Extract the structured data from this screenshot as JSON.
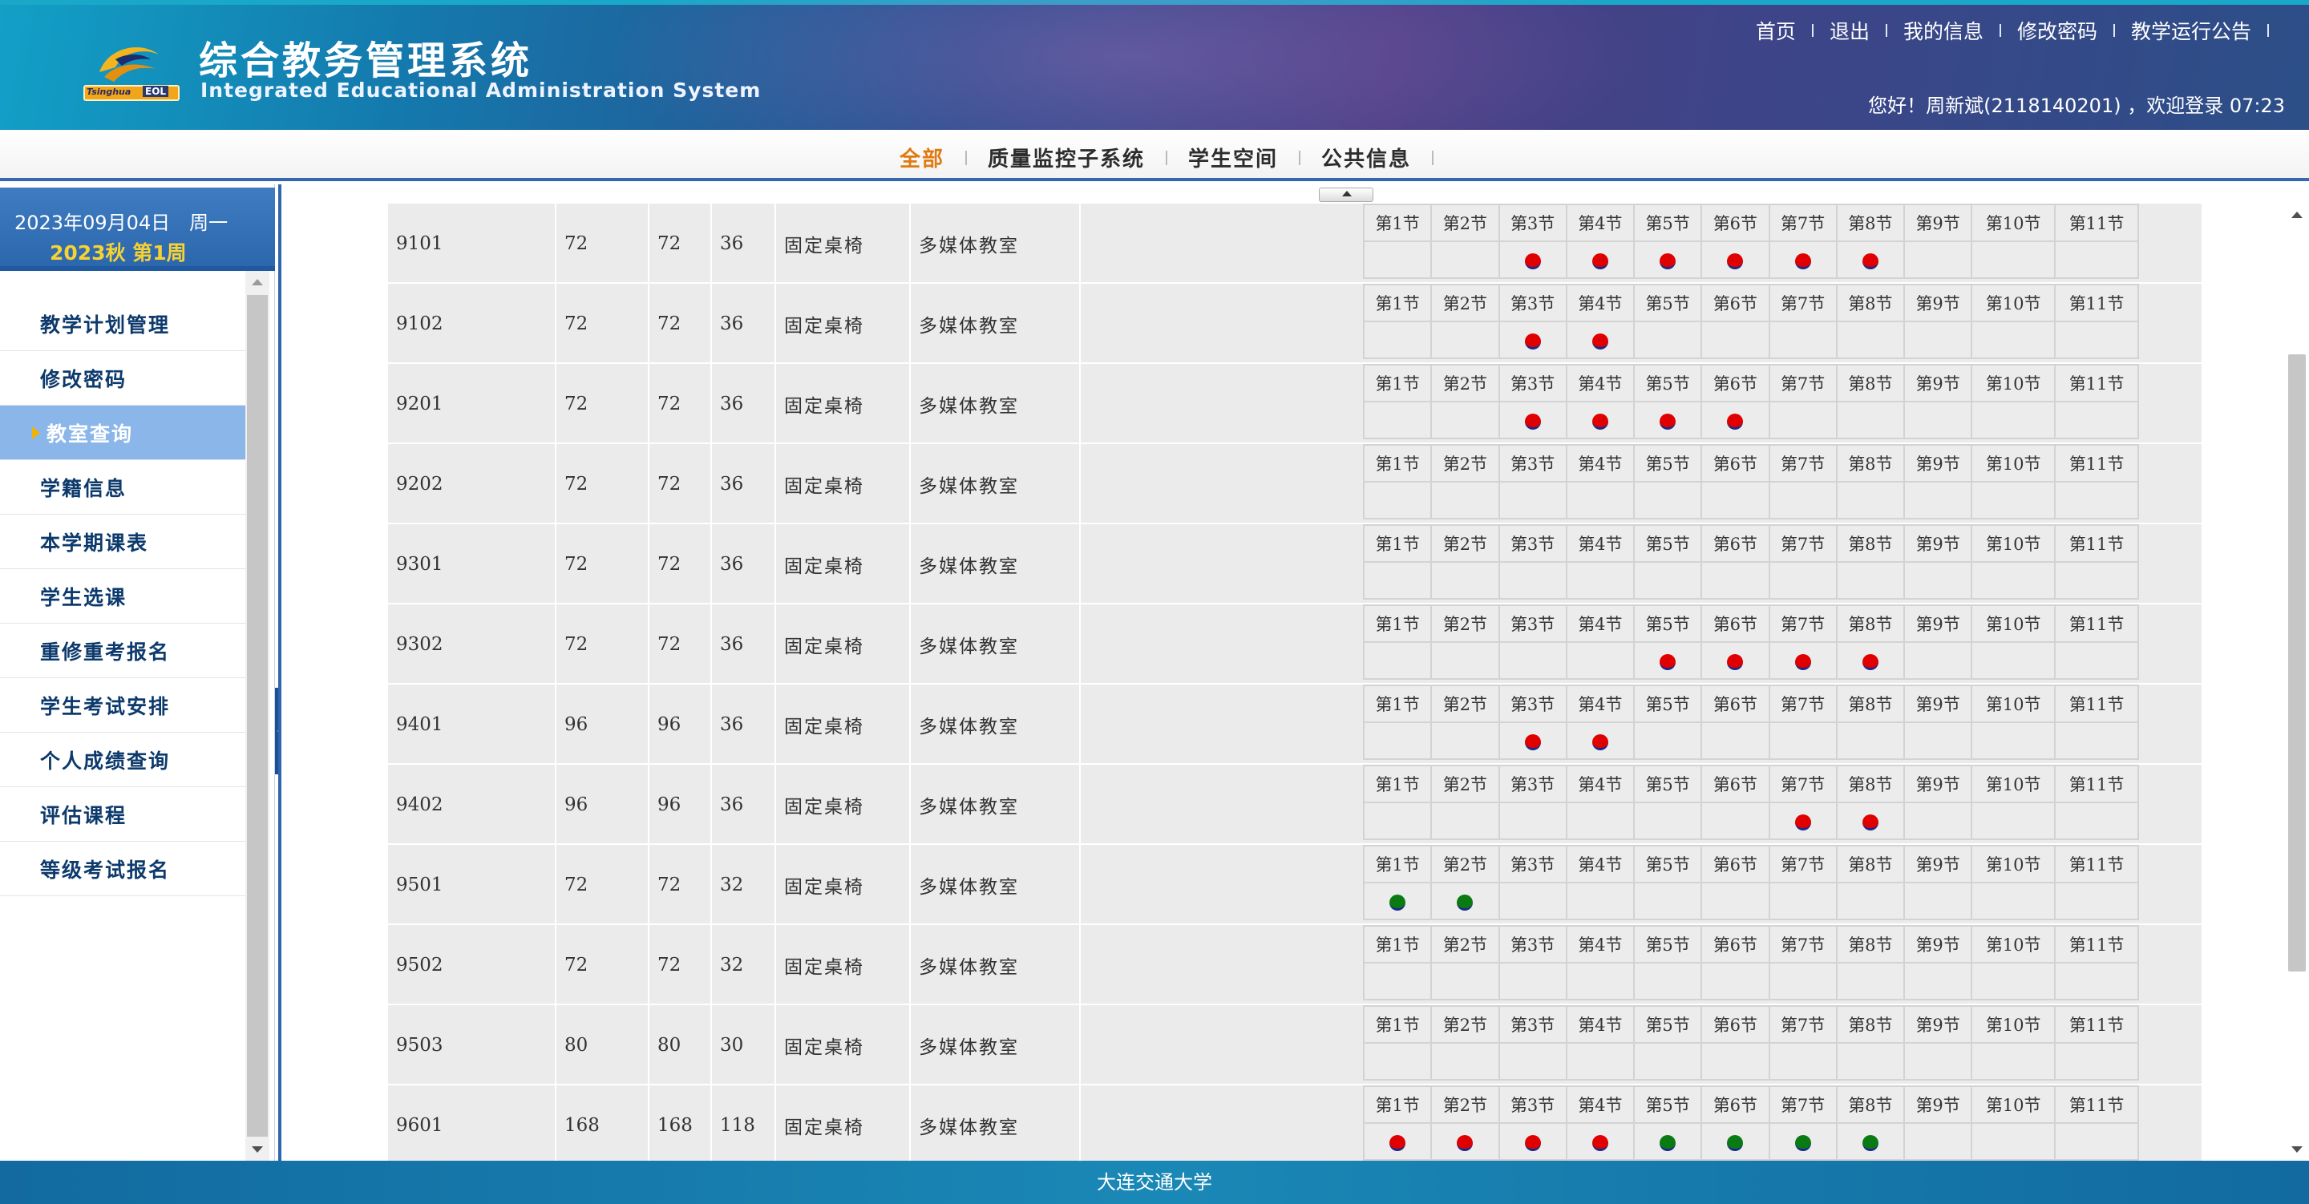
{
  "header": {
    "title_cn": "综合教务管理系统",
    "title_en": "Integrated Educational Administration System",
    "logo_text": "Tsinghua",
    "logo_badge": "EOL",
    "links": [
      "首页",
      "退出",
      "我的信息",
      "修改密码",
      "教学运行公告"
    ],
    "welcome": "您好！周新斌(2118140201) ，欢迎登录 07:23"
  },
  "nav": {
    "items": [
      {
        "label": "全部",
        "active": true
      },
      {
        "label": "质量监控子系统",
        "active": false
      },
      {
        "label": "学生空间",
        "active": false
      },
      {
        "label": "公共信息",
        "active": false
      }
    ]
  },
  "sidebar": {
    "date": "2023年09月04日　周一",
    "week": "2023秋 第1周",
    "menu": [
      {
        "label": "教学计划管理",
        "active": false
      },
      {
        "label": "修改密码",
        "active": false
      },
      {
        "label": "教室查询",
        "active": true
      },
      {
        "label": "学籍信息",
        "active": false
      },
      {
        "label": "本学期课表",
        "active": false
      },
      {
        "label": "学生选课",
        "active": false
      },
      {
        "label": "重修重考报名",
        "active": false
      },
      {
        "label": "学生考试安排",
        "active": false
      },
      {
        "label": "个人成绩查询",
        "active": false
      },
      {
        "label": "评估课程",
        "active": false
      },
      {
        "label": "等级考试报名",
        "active": false
      }
    ]
  },
  "periods": [
    "第1节",
    "第2节",
    "第3节",
    "第4节",
    "第5节",
    "第6节",
    "第7节",
    "第8节",
    "第9节",
    "第10节",
    "第11节"
  ],
  "rooms": [
    {
      "room": "9101",
      "a": "72",
      "b": "72",
      "c": "36",
      "desk": "固定桌椅",
      "type": "多媒体教室",
      "slots": [
        "",
        "",
        "red",
        "red",
        "red",
        "red",
        "red",
        "red",
        "",
        "",
        ""
      ]
    },
    {
      "room": "9102",
      "a": "72",
      "b": "72",
      "c": "36",
      "desk": "固定桌椅",
      "type": "多媒体教室",
      "slots": [
        "",
        "",
        "red",
        "red",
        "",
        "",
        "",
        "",
        "",
        "",
        ""
      ]
    },
    {
      "room": "9201",
      "a": "72",
      "b": "72",
      "c": "36",
      "desk": "固定桌椅",
      "type": "多媒体教室",
      "slots": [
        "",
        "",
        "red",
        "red",
        "red",
        "red",
        "",
        "",
        "",
        "",
        ""
      ]
    },
    {
      "room": "9202",
      "a": "72",
      "b": "72",
      "c": "36",
      "desk": "固定桌椅",
      "type": "多媒体教室",
      "slots": [
        "",
        "",
        "",
        "",
        "",
        "",
        "",
        "",
        "",
        "",
        ""
      ]
    },
    {
      "room": "9301",
      "a": "72",
      "b": "72",
      "c": "36",
      "desk": "固定桌椅",
      "type": "多媒体教室",
      "slots": [
        "",
        "",
        "",
        "",
        "",
        "",
        "",
        "",
        "",
        "",
        ""
      ]
    },
    {
      "room": "9302",
      "a": "72",
      "b": "72",
      "c": "36",
      "desk": "固定桌椅",
      "type": "多媒体教室",
      "slots": [
        "",
        "",
        "",
        "",
        "red",
        "red",
        "red",
        "red",
        "",
        "",
        ""
      ]
    },
    {
      "room": "9401",
      "a": "96",
      "b": "96",
      "c": "36",
      "desk": "固定桌椅",
      "type": "多媒体教室",
      "slots": [
        "",
        "",
        "red",
        "red",
        "",
        "",
        "",
        "",
        "",
        "",
        ""
      ]
    },
    {
      "room": "9402",
      "a": "96",
      "b": "96",
      "c": "36",
      "desk": "固定桌椅",
      "type": "多媒体教室",
      "slots": [
        "",
        "",
        "",
        "",
        "",
        "",
        "red",
        "red",
        "",
        "",
        ""
      ]
    },
    {
      "room": "9501",
      "a": "72",
      "b": "72",
      "c": "32",
      "desk": "固定桌椅",
      "type": "多媒体教室",
      "slots": [
        "green",
        "green",
        "",
        "",
        "",
        "",
        "",
        "",
        "",
        "",
        ""
      ]
    },
    {
      "room": "9502",
      "a": "72",
      "b": "72",
      "c": "32",
      "desk": "固定桌椅",
      "type": "多媒体教室",
      "slots": [
        "",
        "",
        "",
        "",
        "",
        "",
        "",
        "",
        "",
        "",
        ""
      ]
    },
    {
      "room": "9503",
      "a": "80",
      "b": "80",
      "c": "30",
      "desk": "固定桌椅",
      "type": "多媒体教室",
      "slots": [
        "",
        "",
        "",
        "",
        "",
        "",
        "",
        "",
        "",
        "",
        ""
      ]
    },
    {
      "room": "9601",
      "a": "168",
      "b": "168",
      "c": "118",
      "desk": "固定桌椅",
      "type": "多媒体教室",
      "slots": [
        "red",
        "red",
        "red",
        "red",
        "green",
        "green",
        "green",
        "green",
        "",
        "",
        ""
      ]
    }
  ],
  "footer": {
    "text": "大连交通大学"
  },
  "colors": {
    "occupied_red": "#e00000",
    "occupied_green": "#0a7a12",
    "active_nav": "#e07a10",
    "accent_blue": "#2f66ad"
  }
}
